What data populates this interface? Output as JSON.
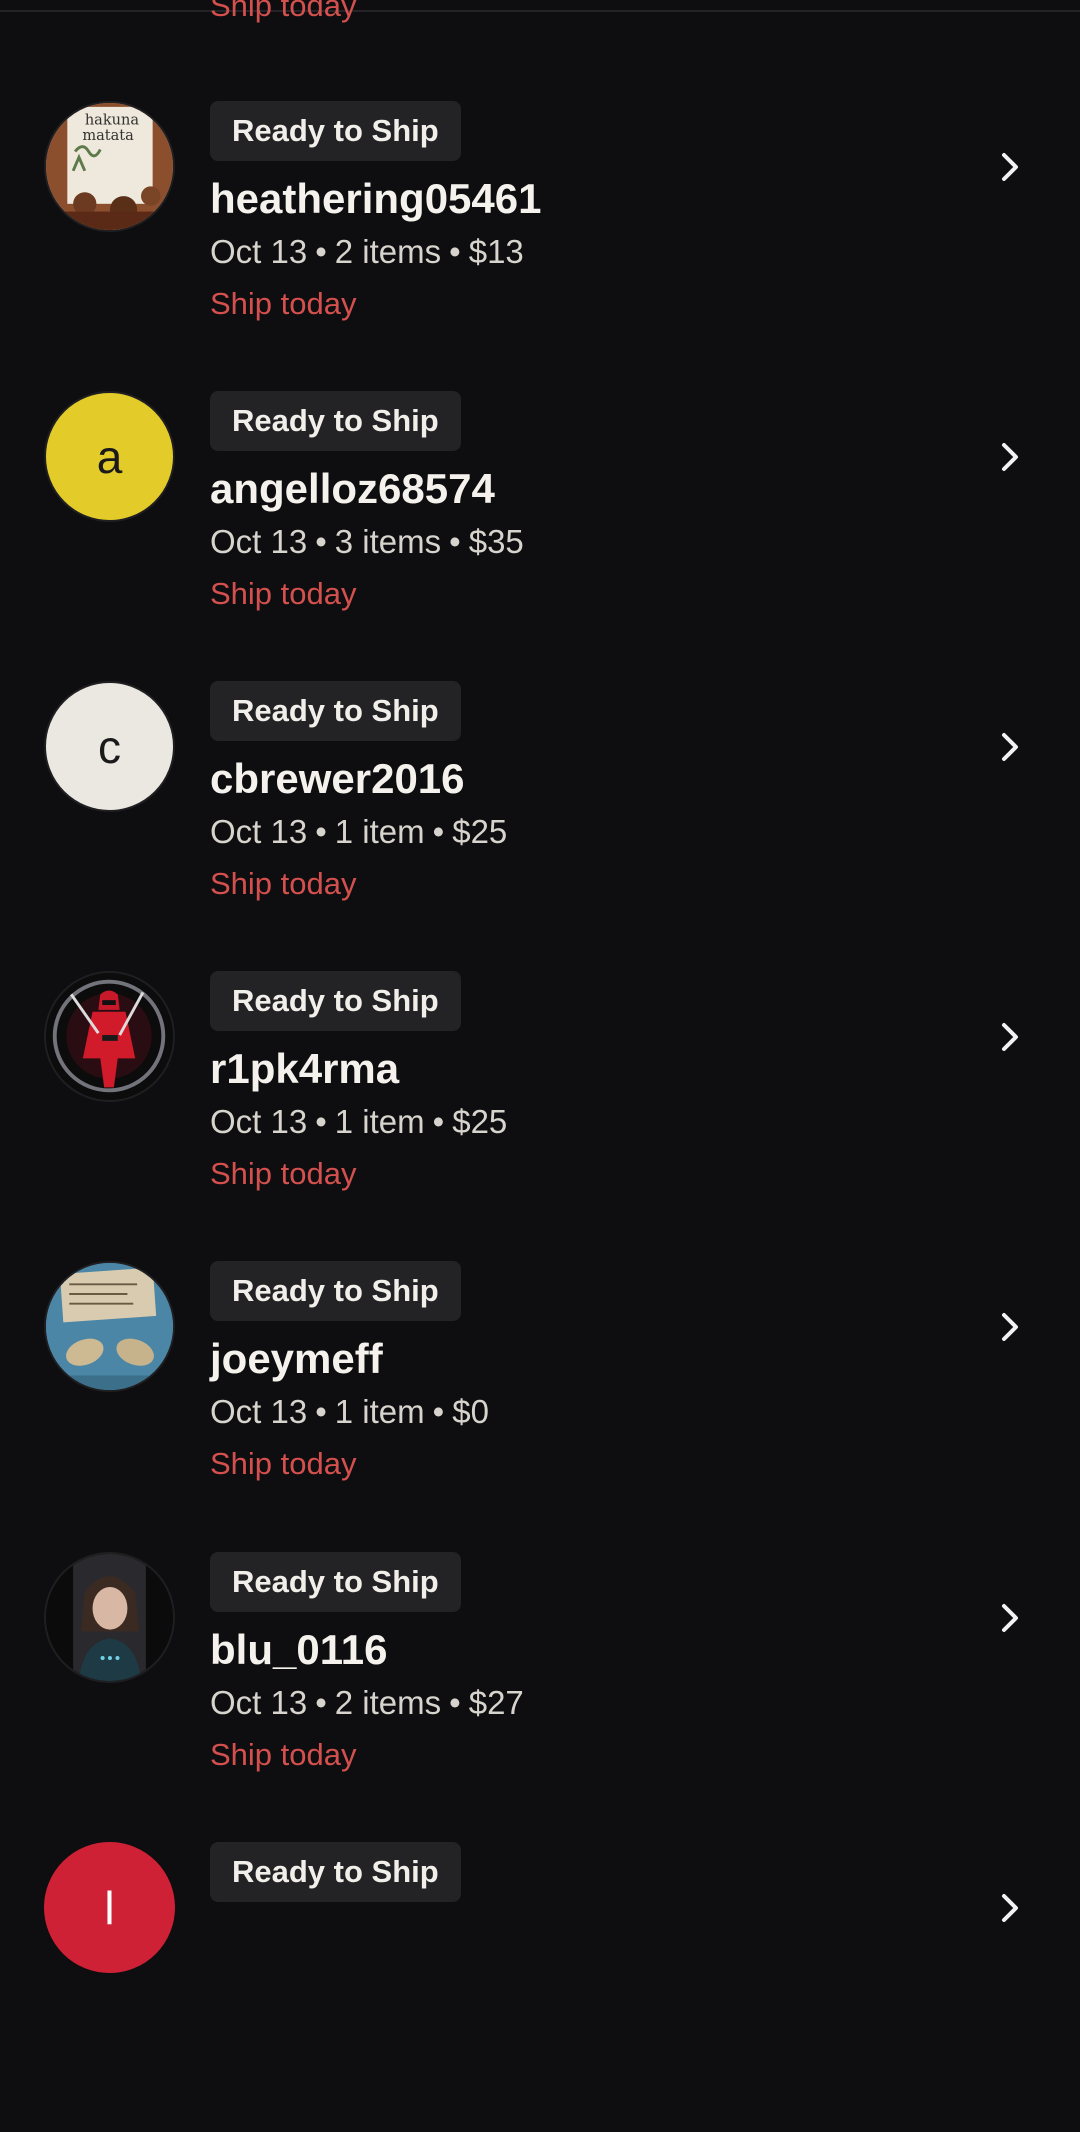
{
  "previous_row": {
    "ship_label": "Ship today"
  },
  "orders": [
    {
      "status": "Ready to Ship",
      "username": "heathering05461",
      "date": "Oct 13",
      "items": "2 items",
      "total": "$13",
      "ship_label": "Ship today",
      "avatar": {
        "type": "image",
        "icon": "photo-avatar-sign",
        "text": "hakuna matata"
      }
    },
    {
      "status": "Ready to Ship",
      "username": "angelloz68574",
      "date": "Oct 13",
      "items": "3 items",
      "total": "$35",
      "ship_label": "Ship today",
      "avatar": {
        "type": "letter",
        "letter": "a",
        "color": "#e3cc2a"
      }
    },
    {
      "status": "Ready to Ship",
      "username": "cbrewer2016",
      "date": "Oct 13",
      "items": "1 item",
      "total": "$25",
      "ship_label": "Ship today",
      "avatar": {
        "type": "letter",
        "letter": "c",
        "color": "#ebe7e1"
      }
    },
    {
      "status": "Ready to Ship",
      "username": "r1pk4rma",
      "date": "Oct 13",
      "items": "1 item",
      "total": "$25",
      "ship_label": "Ship today",
      "avatar": {
        "type": "image",
        "icon": "photo-avatar-ninja"
      }
    },
    {
      "status": "Ready to Ship",
      "username": "joeymeff",
      "date": "Oct 13",
      "items": "1 item",
      "total": "$0",
      "ship_label": "Ship today",
      "avatar": {
        "type": "image",
        "icon": "photo-avatar-items"
      }
    },
    {
      "status": "Ready to Ship",
      "username": "blu_0116",
      "date": "Oct 13",
      "items": "2 items",
      "total": "$27",
      "ship_label": "Ship today",
      "avatar": {
        "type": "image",
        "icon": "photo-avatar-person"
      }
    },
    {
      "status": "Ready to Ship",
      "avatar": {
        "type": "letter",
        "letter": "l",
        "color": "#cf2136"
      }
    }
  ],
  "colors": {
    "background": "#0e0e10",
    "badge_bg": "#232326",
    "ship_today": "#d4504e"
  }
}
